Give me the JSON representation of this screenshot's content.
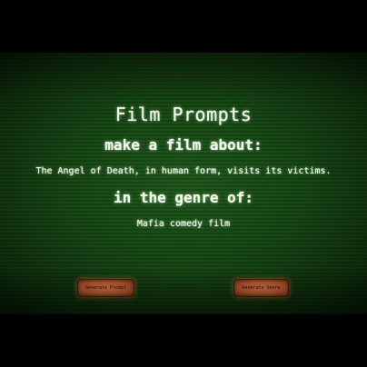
{
  "app": {
    "title": "Film Prompts",
    "about_heading": "make a film about:",
    "prompt": "The Angel of Death, in human form, visits its victims.",
    "genre_heading": "in the genre of:",
    "genre": "Mafia comedy film"
  },
  "buttons": {
    "generate_prompt": "Generate Prompt",
    "generate_genre": "Generate Genre"
  },
  "colors": {
    "screen_green": "#174a14",
    "text": "#f2f7ee",
    "button": "#b85a33"
  }
}
